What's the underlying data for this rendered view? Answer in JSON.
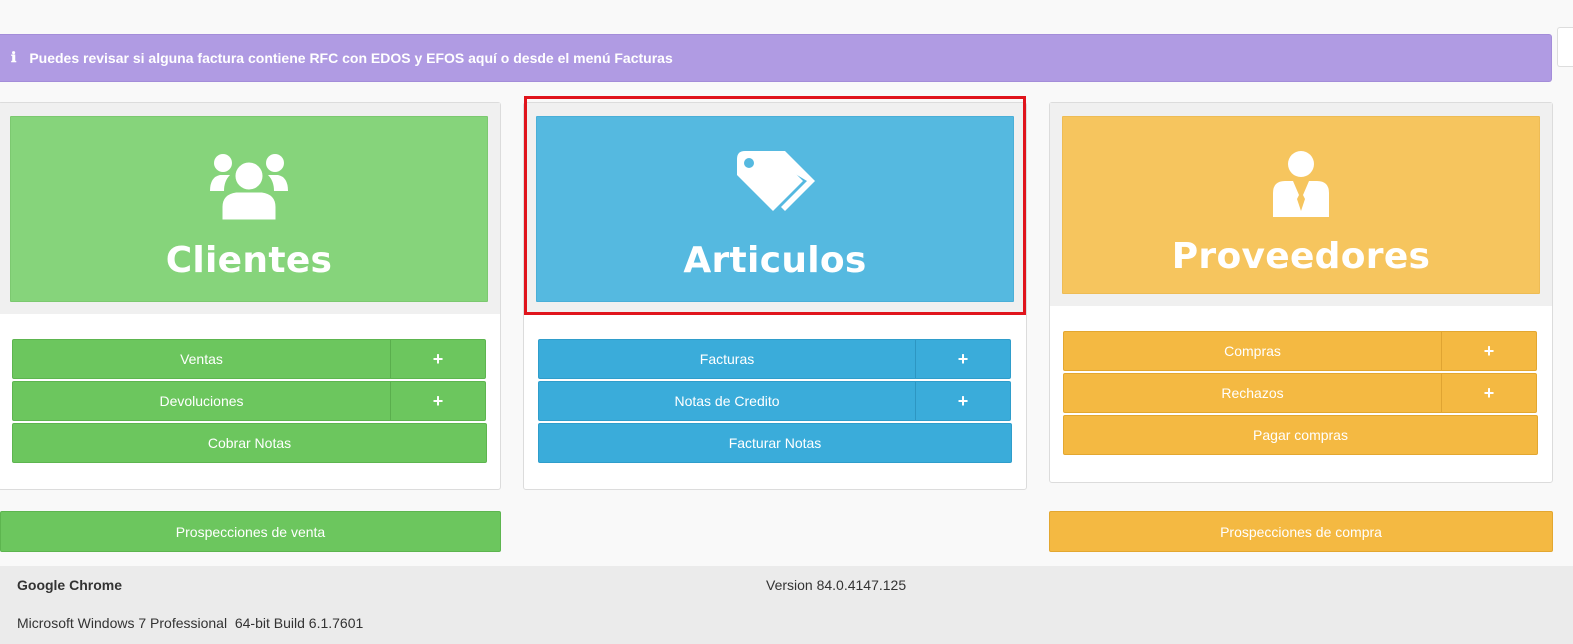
{
  "alert": {
    "icon": "info-icon",
    "icon_glyph": "ℹ",
    "text": "Puedes revisar si alguna factura contiene RFC con EDOS y EFOS aquí o desde el menú Facturas"
  },
  "clientes": {
    "title": "Clientes",
    "icon": "users-icon",
    "color": "#86d47b",
    "buttons": {
      "ventas": "Ventas",
      "devoluciones": "Devoluciones",
      "cobrar_notas": "Cobrar Notas",
      "plus": "+"
    },
    "prospecciones": "Prospecciones de venta"
  },
  "articulos": {
    "title": "Articulos",
    "icon": "tags-icon",
    "color": "#55b9e0",
    "buttons": {
      "facturas": "Facturas",
      "notas_credito": "Notas de Credito",
      "facturar_notas": "Facturar Notas",
      "plus": "+"
    }
  },
  "proveedores": {
    "title": "Proveedores",
    "icon": "businessman-icon",
    "color": "#f6c55e",
    "buttons": {
      "compras": "Compras",
      "rechazos": "Rechazos",
      "pagar_compras": "Pagar compras",
      "plus": "+"
    },
    "prospecciones": "Prospecciones de compra"
  },
  "footer": {
    "browser": "Google Chrome",
    "version": "Version 84.0.4147.125",
    "os": "Microsoft Windows 7 Professional  64-bit Build 6.1.7601"
  }
}
